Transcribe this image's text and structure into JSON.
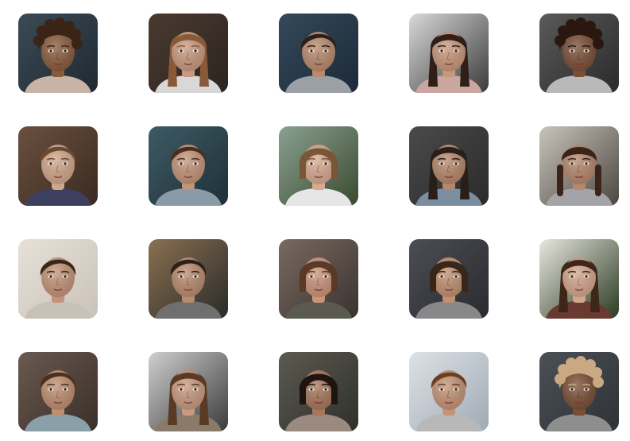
{
  "portraits": [
    {
      "bg": "#1f2a33",
      "bg2": "#3b4a55",
      "skin": "#8a5a3c",
      "hair": "#3a2416",
      "hair_style": "curly",
      "shirt": "#c9b3a8"
    },
    {
      "bg": "#2b2420",
      "bg2": "#4a3a30",
      "skin": "#c99a80",
      "hair": "#8a5a38",
      "hair_style": "long",
      "shirt": "#d8d8d8"
    },
    {
      "bg": "#1c2a38",
      "bg2": "#34495a",
      "skin": "#b98a6c",
      "hair": "#2a1f1a",
      "hair_style": "short",
      "shirt": "#9aa0a6"
    },
    {
      "bg": "#3a3a3a",
      "bg2": "#d9d9d9",
      "skin": "#c9987a",
      "hair": "#2e2018",
      "hair_style": "long",
      "shirt": "#c9a6a0"
    },
    {
      "bg": "#2a2a2a",
      "bg2": "#5a5a5a",
      "skin": "#7a4e36",
      "hair": "#2a1810",
      "hair_style": "curly",
      "shirt": "#b9b9b9"
    },
    {
      "bg": "#3a2a20",
      "bg2": "#6a5040",
      "skin": "#d1a68a",
      "hair": "#6a4a2e",
      "hair_style": "short",
      "shirt": "#3c3f5e"
    },
    {
      "bg": "#1e3038",
      "bg2": "#3e5a64",
      "skin": "#c49478",
      "hair": "#4a2e1e",
      "hair_style": "short",
      "shirt": "#8a9aa6"
    },
    {
      "bg": "#3a4a30",
      "bg2": "#8aa090",
      "skin": "#d8aa90",
      "hair": "#7a5638",
      "hair_style": "bob",
      "shirt": "#e6e6e6"
    },
    {
      "bg": "#2a2a2a",
      "bg2": "#4a4a4a",
      "skin": "#b7876a",
      "hair": "#2a1e18",
      "hair_style": "long",
      "shirt": "#7a8ea0"
    },
    {
      "bg": "#4a4640",
      "bg2": "#c9c4bb",
      "skin": "#b5876c",
      "hair": "#3a2418",
      "hair_style": "braids",
      "shirt": "#a3a3a8"
    },
    {
      "bg": "#c9c2b8",
      "bg2": "#e6e0d6",
      "skin": "#c49378",
      "hair": "#3a2618",
      "hair_style": "short",
      "shirt": "#c7c2b8"
    },
    {
      "bg": "#2a2a2a",
      "bg2": "#8a7050",
      "skin": "#b98b6e",
      "hair": "#2e2018",
      "hair_style": "short",
      "shirt": "#6f6f6f"
    },
    {
      "bg": "#3a3230",
      "bg2": "#7a6a60",
      "skin": "#c99478",
      "hair": "#5a3a26",
      "hair_style": "bob",
      "shirt": "#5a5a50"
    },
    {
      "bg": "#2a2a2e",
      "bg2": "#4a4e55",
      "skin": "#c09070",
      "hair": "#3a2618",
      "hair_style": "bob",
      "shirt": "#888888"
    },
    {
      "bg": "#2a3a20",
      "bg2": "#e8e6e0",
      "skin": "#d4a58c",
      "hair": "#3e2618",
      "hair_style": "long",
      "shirt": "#6a3a30"
    },
    {
      "bg": "#3a2e28",
      "bg2": "#6a5a50",
      "skin": "#c08e70",
      "hair": "#4a3020",
      "hair_style": "short",
      "shirt": "#8aa0a8"
    },
    {
      "bg": "#3a3a3a",
      "bg2": "#cfcfcf",
      "skin": "#c99a7e",
      "hair": "#5a3a24",
      "hair_style": "long",
      "shirt": "#8a7a6a"
    },
    {
      "bg": "#30302c",
      "bg2": "#5a5a50",
      "skin": "#a8765a",
      "hair": "#1e1410",
      "hair_style": "bob",
      "shirt": "#9a8a80"
    },
    {
      "bg": "#a0aab4",
      "bg2": "#dde2e6",
      "skin": "#c49476",
      "hair": "#6a3e22",
      "hair_style": "short",
      "shirt": "#b8b8b8"
    },
    {
      "bg": "#2e3236",
      "bg2": "#4a5056",
      "skin": "#7a4e34",
      "hair": "#c9a882",
      "hair_style": "curly",
      "shirt": "#8e8e8e"
    }
  ]
}
